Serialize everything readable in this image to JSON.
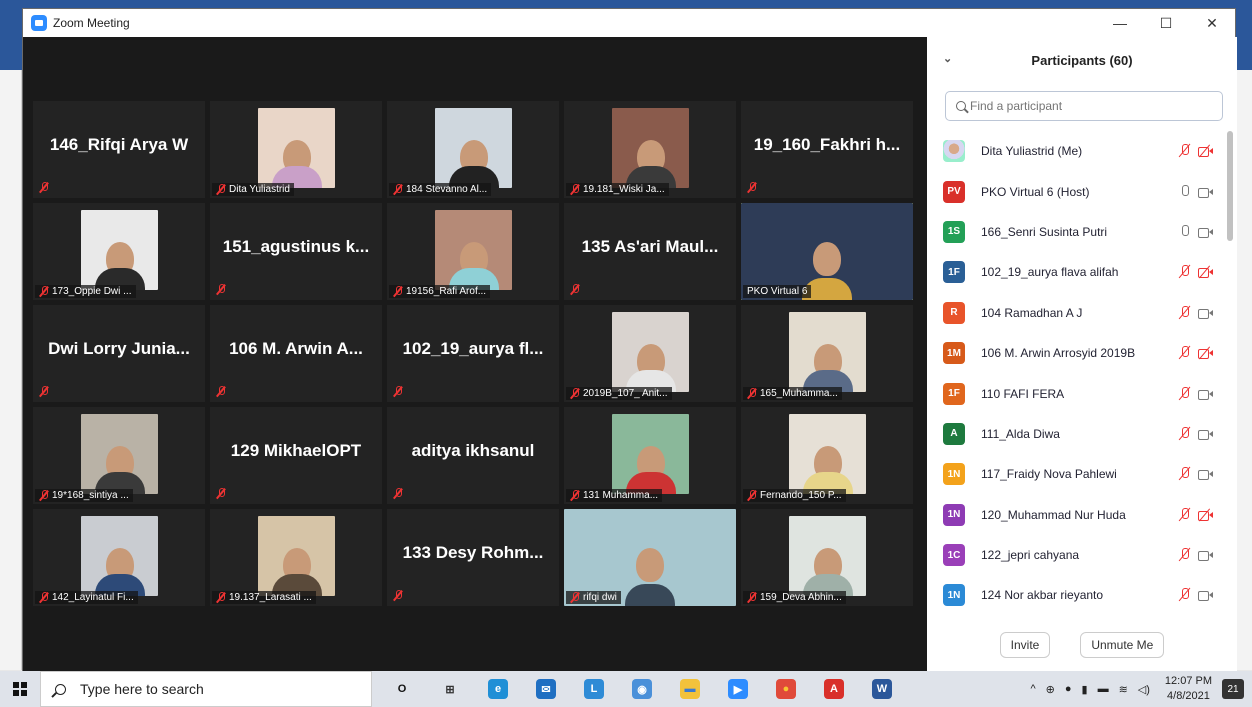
{
  "window": {
    "title": "Zoom Meeting"
  },
  "tiles": [
    {
      "name": "146_Rifqi Arya W",
      "video": false,
      "label": ""
    },
    {
      "name": "",
      "video": true,
      "label": "Dita Yuliastrid",
      "bg": "#e9d6c8",
      "shirt": "#c9a0c8"
    },
    {
      "name": "",
      "video": true,
      "label": "184 Stevanno Al...",
      "bg": "#cfd7de",
      "shirt": "#222"
    },
    {
      "name": "",
      "video": true,
      "label": "19.181_Wiski Ja...",
      "bg": "#8a5b4c",
      "shirt": "#3a3a3a"
    },
    {
      "name": "19_160_Fakhri h...",
      "video": false,
      "label": ""
    },
    {
      "name": "",
      "video": true,
      "label": "173_Oppie Dwi ...",
      "bg": "#e9e9e9",
      "shirt": "#2a2a2a"
    },
    {
      "name": "151_agustinus k...",
      "video": false,
      "label": ""
    },
    {
      "name": "",
      "video": true,
      "label": "19156_Rafi Arof...",
      "bg": "#b58a77",
      "shirt": "#8fd0d6"
    },
    {
      "name": "135 As'ari Maul...",
      "video": false,
      "label": ""
    },
    {
      "name": "",
      "video": true,
      "wide": true,
      "active": true,
      "label": "PKO Virtual 6",
      "bg": "#2e3c57",
      "shirt": "#d4a640"
    },
    {
      "name": "Dwi Lorry Junia...",
      "video": false,
      "label": ""
    },
    {
      "name": "106 M. Arwin A...",
      "video": false,
      "label": ""
    },
    {
      "name": "102_19_aurya fl...",
      "video": false,
      "label": ""
    },
    {
      "name": "",
      "video": true,
      "label": "2019B_107_ Anit...",
      "bg": "#d9d3cf",
      "shirt": "#e6e6e6"
    },
    {
      "name": "",
      "video": true,
      "label": "165_Muhamma...",
      "bg": "#e3dccf",
      "shirt": "#5a6b88"
    },
    {
      "name": "",
      "video": true,
      "label": "19*168_sintiya ...",
      "bg": "#b9b2a6",
      "shirt": "#3a3a3a"
    },
    {
      "name": "129 MikhaelOPT",
      "video": false,
      "label": ""
    },
    {
      "name": "aditya ikhsanul",
      "video": false,
      "label": ""
    },
    {
      "name": "",
      "video": true,
      "label": "131 Muhamma...",
      "bg": "#8ab89a",
      "shirt": "#c33"
    },
    {
      "name": "",
      "video": true,
      "label": "Fernando_150 P...",
      "bg": "#e6e0d6",
      "shirt": "#e7d58a"
    },
    {
      "name": "",
      "video": true,
      "label": "142_Layinatul Fi...",
      "bg": "#c9ccd1",
      "shirt": "#2d4a78"
    },
    {
      "name": "",
      "video": true,
      "label": "19.137_Larasati ...",
      "bg": "#d6c4a7",
      "shirt": "#5a4a3a"
    },
    {
      "name": "133 Desy Rohm...",
      "video": false,
      "label": ""
    },
    {
      "name": "",
      "video": true,
      "wide": true,
      "label": "rifqi dwi",
      "bg": "#a7c7cf",
      "shirt": "#384858"
    },
    {
      "name": "",
      "video": true,
      "label": "159_Deva Abhin...",
      "bg": "#dfe4e0",
      "shirt": "#9fb0a8"
    }
  ],
  "panel": {
    "title": "Participants (60)",
    "search_placeholder": "Find a participant",
    "invite": "Invite",
    "unmute": "Unmute Me",
    "participants": [
      {
        "initials": "",
        "color": "",
        "name": "Dita Yuliastrid (Me)",
        "mic": "off",
        "cam": "off"
      },
      {
        "initials": "PV",
        "color": "#d9302a",
        "name": "PKO Virtual 6 (Host)",
        "mic": "on",
        "cam": "on"
      },
      {
        "initials": "1S",
        "color": "#23a057",
        "name": "166_Senri Susinta Putri",
        "mic": "on",
        "cam": "on"
      },
      {
        "initials": "1F",
        "color": "#2a5f96",
        "name": "102_19_aurya flava alifah",
        "mic": "off",
        "cam": "off"
      },
      {
        "initials": "R",
        "color": "#e8542a",
        "name": "104 Ramadhan A J",
        "mic": "off",
        "cam": "on"
      },
      {
        "initials": "1M",
        "color": "#d75a1a",
        "name": "106 M. Arwin Arrosyid 2019B",
        "mic": "off",
        "cam": "off"
      },
      {
        "initials": "1F",
        "color": "#e0661d",
        "name": "110 FAFI FERA",
        "mic": "off",
        "cam": "on"
      },
      {
        "initials": "A",
        "color": "#1e7a3e",
        "name": "111_Alda Diwa",
        "mic": "off",
        "cam": "on"
      },
      {
        "initials": "1N",
        "color": "#f3a21b",
        "name": "117_Fraidy Nova Pahlewi",
        "mic": "off",
        "cam": "on"
      },
      {
        "initials": "1N",
        "color": "#8e3bb4",
        "name": "120_Muhammad Nur Huda",
        "mic": "off",
        "cam": "off"
      },
      {
        "initials": "1C",
        "color": "#9a3fb8",
        "name": "122_jepri cahyana",
        "mic": "off",
        "cam": "on"
      },
      {
        "initials": "1N",
        "color": "#2b8ad6",
        "name": "124 Nor akbar rieyanto",
        "mic": "off",
        "cam": "on"
      }
    ]
  },
  "taskbar": {
    "search_text": "Type here to search",
    "apps": [
      {
        "name": "cortana-icon",
        "glyph": "O",
        "color": "transparent",
        "fg": "#111"
      },
      {
        "name": "task-view-icon",
        "glyph": "⊞",
        "color": "transparent",
        "fg": "#333"
      },
      {
        "name": "edge-icon",
        "glyph": "e",
        "color": "#1f8fd6",
        "fg": "#fff"
      },
      {
        "name": "mail-icon",
        "glyph": "✉",
        "color": "#1f6fc2",
        "fg": "#fff"
      },
      {
        "name": "l-app-icon",
        "glyph": "L",
        "color": "#2e8bd6",
        "fg": "#fff"
      },
      {
        "name": "globe-icon",
        "glyph": "◉",
        "color": "#4a90d9",
        "fg": "#fff"
      },
      {
        "name": "file-explorer-icon",
        "glyph": "▬",
        "color": "#f2c23b",
        "fg": "#3a7ad0"
      },
      {
        "name": "zoom-icon",
        "glyph": "▶",
        "color": "#2d8cff",
        "fg": "#fff"
      },
      {
        "name": "chrome-icon",
        "glyph": "●",
        "color": "#e04a3a",
        "fg": "#f7c532"
      },
      {
        "name": "acrobat-icon",
        "glyph": "A",
        "color": "#d9302a",
        "fg": "#fff"
      },
      {
        "name": "word-icon",
        "glyph": "W",
        "color": "#2b579a",
        "fg": "#fff"
      }
    ],
    "time": "12:07 PM",
    "date": "4/8/2021",
    "notifications": "21"
  }
}
